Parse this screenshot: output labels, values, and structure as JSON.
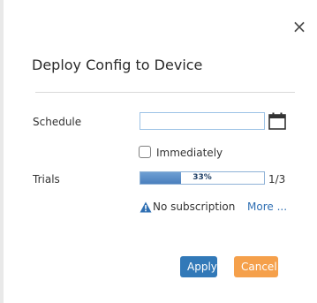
{
  "dialog": {
    "title": "Deploy Config to Device",
    "close_label": "×"
  },
  "form": {
    "schedule_label": "Schedule",
    "schedule_value": "",
    "immediately_label": "Immediately",
    "immediately_checked": false,
    "trials_label": "Trials",
    "trials_progress_percent": 33,
    "trials_progress_text": "33%",
    "trials_count": "1/3",
    "subscription_warning": "No subscription",
    "more_link": "More ..."
  },
  "buttons": {
    "apply": "Apply",
    "cancel": "Cancel"
  },
  "colors": {
    "accent": "#3279b8",
    "cancel": "#f5a04b",
    "link": "#2f6fb3",
    "warning_icon": "#2f6fb3"
  },
  "icons": {
    "calendar": "calendar-icon",
    "warning": "warning-icon",
    "close": "close-icon"
  }
}
